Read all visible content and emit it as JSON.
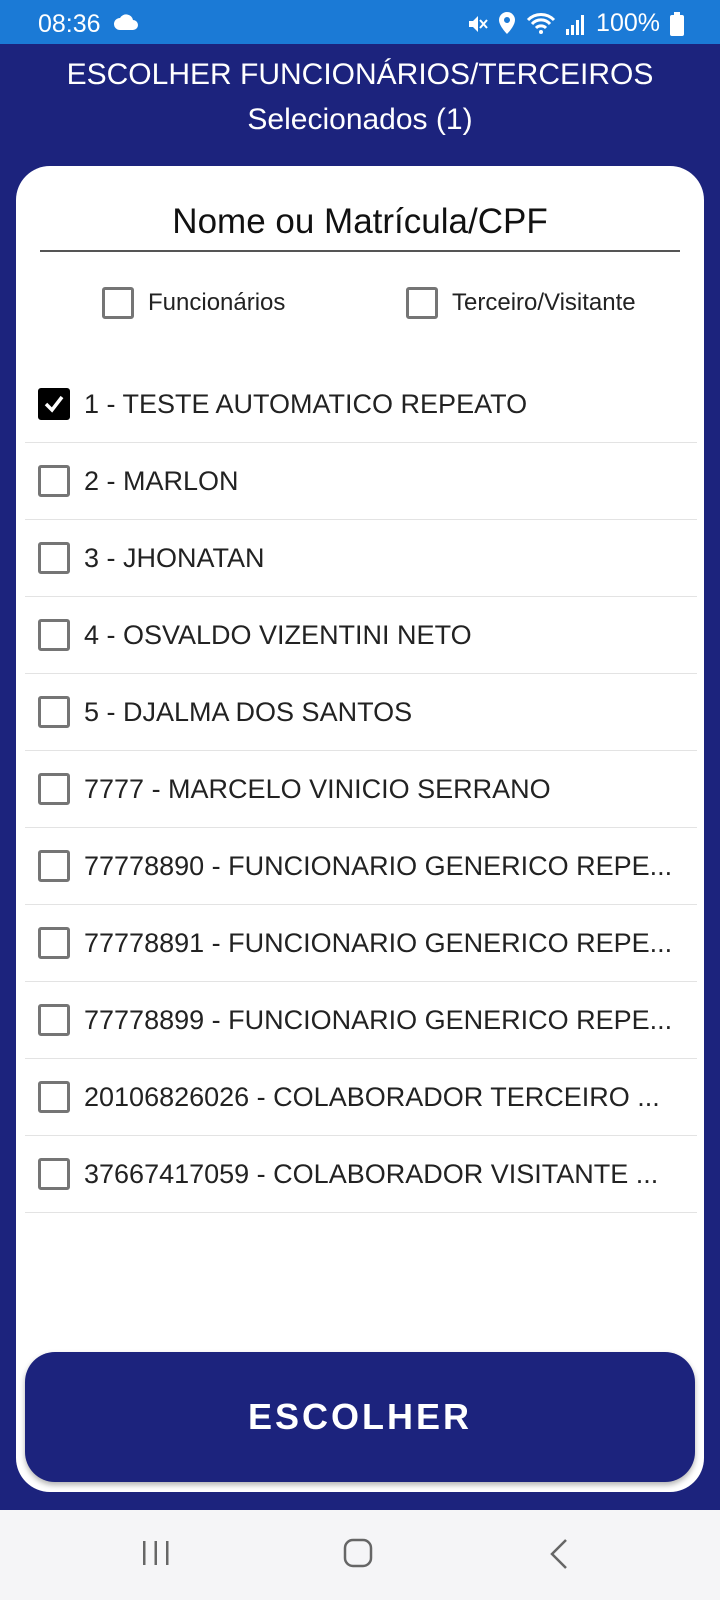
{
  "status_bar": {
    "time": "08:36",
    "battery": "100%",
    "icons": [
      "cloud-icon",
      "mute-icon",
      "location-icon",
      "wifi-icon",
      "signal-icon",
      "battery-icon"
    ]
  },
  "header": {
    "title": "ESCOLHER FUNCIONÁRIOS/TERCEIROS",
    "subtitle": "Selecionados (1)"
  },
  "search": {
    "placeholder": "Nome ou Matrícula/CPF",
    "value": ""
  },
  "filters": {
    "funcionarios": {
      "label": "Funcionários",
      "checked": false
    },
    "terceiros": {
      "label": "Terceiro/Visitante",
      "checked": false
    }
  },
  "items": [
    {
      "label": "1 - TESTE AUTOMATICO REPEATO",
      "checked": true
    },
    {
      "label": "2 - MARLON",
      "checked": false
    },
    {
      "label": "3 - JHONATAN",
      "checked": false
    },
    {
      "label": "4 - OSVALDO VIZENTINI NETO",
      "checked": false
    },
    {
      "label": "5 - DJALMA DOS SANTOS",
      "checked": false
    },
    {
      "label": "7777 - MARCELO VINICIO SERRANO",
      "checked": false
    },
    {
      "label": "77778890 - FUNCIONARIO GENERICO REPE...",
      "checked": false
    },
    {
      "label": "77778891 - FUNCIONARIO GENERICO REPE...",
      "checked": false
    },
    {
      "label": "77778899 - FUNCIONARIO GENERICO REPE...",
      "checked": false
    },
    {
      "label": "20106826026 - COLABORADOR TERCEIRO ...",
      "checked": false
    },
    {
      "label": "37667417059 - COLABORADOR VISITANTE ...",
      "checked": false
    }
  ],
  "button": {
    "label": "ESCOLHER"
  },
  "colors": {
    "status_bar": "#1b7ad6",
    "primary": "#1c237d",
    "card": "#ffffff"
  }
}
